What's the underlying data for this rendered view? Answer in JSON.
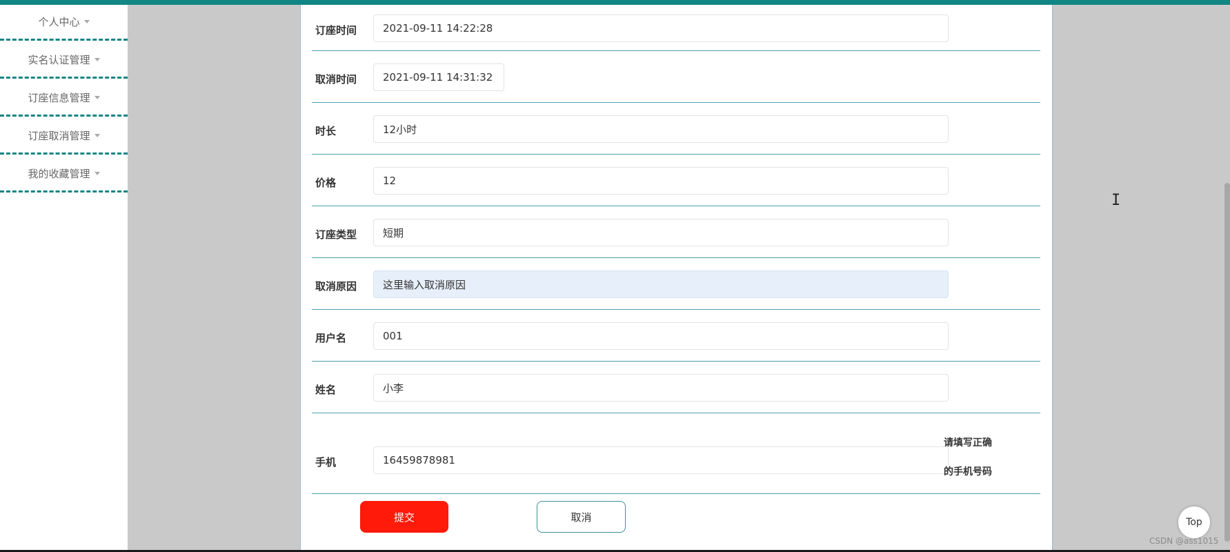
{
  "sidebar": {
    "items": [
      {
        "label": "个人中心"
      },
      {
        "label": "实名认证管理"
      },
      {
        "label": "订座信息管理"
      },
      {
        "label": "订座取消管理"
      },
      {
        "label": "我的收藏管理"
      }
    ]
  },
  "form": {
    "booking_time": {
      "label": "订座时间",
      "value": "2021-09-11 14:22:28"
    },
    "cancel_time": {
      "label": "取消时间",
      "value": "2021-09-11 14:31:32"
    },
    "duration": {
      "label": "时长",
      "value": "12小时"
    },
    "price": {
      "label": "价格",
      "value": "12"
    },
    "booking_type": {
      "label": "订座类型",
      "value": "短期"
    },
    "cancel_reason": {
      "label": "取消原因",
      "placeholder": "这里输入取消原因"
    },
    "username": {
      "label": "用户名",
      "value": "001"
    },
    "name": {
      "label": "姓名",
      "value": "小李"
    },
    "phone": {
      "label": "手机",
      "value": "16459878981",
      "hint_line1": "请填写正确",
      "hint_line2": "的手机号码"
    },
    "submit_label": "提交",
    "cancel_label": "取消"
  },
  "top_button_label": "Top",
  "watermark": "CSDN @ass1015",
  "colors": {
    "accent": "#128585",
    "submit": "#ff1a0a",
    "focus_bg": "#e6effa"
  }
}
